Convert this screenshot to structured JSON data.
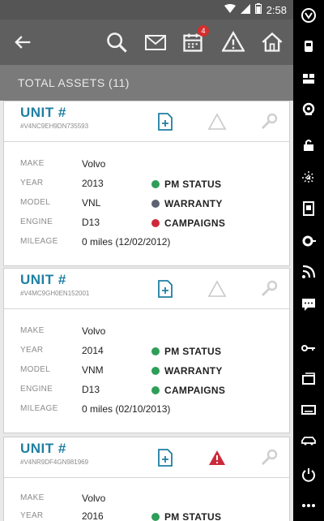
{
  "status_bar": {
    "time": "2:58"
  },
  "app_bar": {
    "calendar_badge": "4"
  },
  "header": {
    "title": "TOTAL ASSETS (11)"
  },
  "colors": {
    "green": "#2e9e58",
    "gray": "#5d6470",
    "red": "#cc2a3a",
    "unit_blue": "#1f7fa3"
  },
  "units": [
    {
      "unit_label": "UNIT #",
      "vin": "#V4NC9EH9DN735593",
      "alert_active": false,
      "rows": [
        {
          "label": "MAKE",
          "value": "Volvo"
        },
        {
          "label": "YEAR",
          "value": "2013"
        },
        {
          "label": "MODEL",
          "value": "VNL"
        },
        {
          "label": "ENGINE",
          "value": "D13"
        },
        {
          "label": "MILEAGE",
          "value": "0 miles (12/02/2012)"
        }
      ],
      "statuses": [
        {
          "text": "PM STATUS",
          "color": "green"
        },
        {
          "text": "WARRANTY",
          "color": "gray"
        },
        {
          "text": "CAMPAIGNS",
          "color": "red"
        }
      ]
    },
    {
      "unit_label": "UNIT #",
      "vin": "#V4MC9GH0EN152001",
      "alert_active": false,
      "rows": [
        {
          "label": "MAKE",
          "value": "Volvo"
        },
        {
          "label": "YEAR",
          "value": "2014"
        },
        {
          "label": "MODEL",
          "value": "VNM"
        },
        {
          "label": "ENGINE",
          "value": "D13"
        },
        {
          "label": "MILEAGE",
          "value": "0 miles (02/10/2013)"
        }
      ],
      "statuses": [
        {
          "text": "PM STATUS",
          "color": "green"
        },
        {
          "text": "WARRANTY",
          "color": "green"
        },
        {
          "text": "CAMPAIGNS",
          "color": "green"
        }
      ]
    },
    {
      "unit_label": "UNIT #",
      "vin": "#V4NR9DF4GN981969",
      "alert_active": true,
      "rows": [
        {
          "label": "MAKE",
          "value": "Volvo"
        },
        {
          "label": "YEAR",
          "value": "2016"
        }
      ],
      "statuses": [
        {
          "text": "PM STATUS",
          "color": "green"
        }
      ]
    }
  ]
}
